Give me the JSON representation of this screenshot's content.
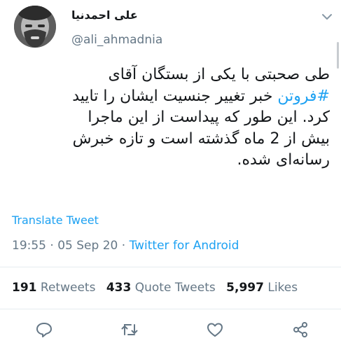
{
  "user": {
    "display_name": "علی احمدنیا",
    "handle": "@ali_ahmadnia"
  },
  "tweet": {
    "line1": "طی صحبتی با یکی از بستگان آقای",
    "hashtag": "#فروتن",
    "line2_rest": " خبر تغییر جنسیت ایشان را تایید",
    "line3": "کرد. این طور که پیداست از این ماجرا",
    "line4": "بیش از 2 ماه گذشته است و تازه خبرش",
    "line5": "رسانه‌ای شده."
  },
  "translate_label": "Translate Tweet",
  "meta": {
    "time": "19:55",
    "date": "05 Sep 20",
    "source": "Twitter for Android"
  },
  "stats": {
    "retweets_count": "191",
    "retweets_label": "Retweets",
    "quotes_count": "433",
    "quotes_label": "Quote Tweets",
    "likes_count": "5,997",
    "likes_label": "Likes"
  },
  "icons": {
    "reply": "reply-icon",
    "retweet": "retweet-icon",
    "like": "heart-icon",
    "share": "share-icon",
    "more": "chevron-down-icon"
  },
  "colors": {
    "accent": "#1da1f2",
    "secondary_text": "#657786",
    "primary_text": "#14171a"
  }
}
